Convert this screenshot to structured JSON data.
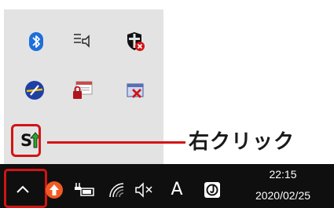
{
  "callout": {
    "label": "右クリック"
  },
  "tray_popup": {
    "icons": [
      {
        "name": "bluetooth-icon"
      },
      {
        "name": "speaker-notes-icon"
      },
      {
        "name": "security-shield-icon"
      },
      {
        "name": "network-adapter-icon"
      },
      {
        "name": "locked-window-icon"
      },
      {
        "name": "removed-hardware-icon"
      },
      {
        "name": "sync-update-icon"
      }
    ]
  },
  "taskbar": {
    "ime_label": "A",
    "clock": {
      "time": "22:15",
      "date": "2020/02/25"
    }
  },
  "colors": {
    "highlight": "#d21414",
    "popup_bg": "#e3e3e3",
    "taskbar_bg": "#0f0f0f",
    "bluetooth": "#1e6fd9"
  }
}
